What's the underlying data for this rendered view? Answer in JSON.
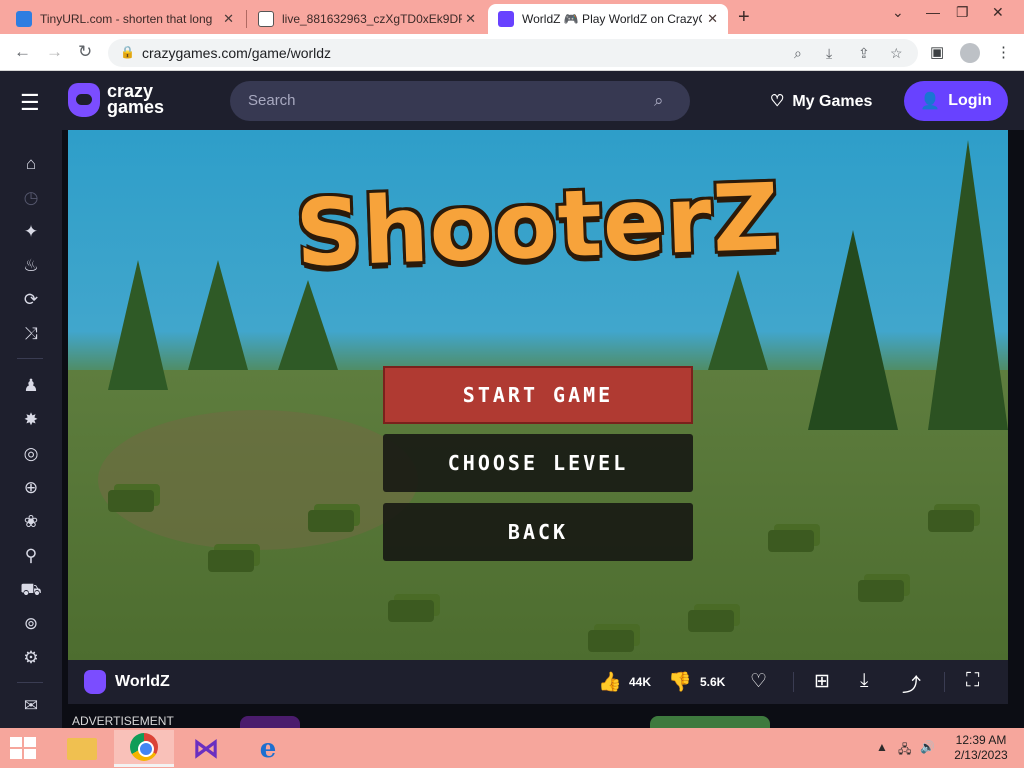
{
  "browser": {
    "tabs": [
      {
        "title": "TinyURL.com - shorten that long",
        "favicon": "tinyurl-icon"
      },
      {
        "title": "live_881632963_czXgTD0xEk9DR",
        "favicon": "file-icon"
      },
      {
        "title": "WorldZ 🎮 Play WorldZ on CrazyG",
        "favicon": "crazygames-icon",
        "active": true
      }
    ],
    "url": "crazygames.com/game/worldz"
  },
  "header": {
    "logo_line1": "crazy",
    "logo_line2": "games",
    "search_placeholder": "Search",
    "my_games": "My Games",
    "login": "Login"
  },
  "sidebar": {
    "icons": [
      "home-icon",
      "recent-icon",
      "new-icon",
      "trending-icon",
      "updated-icon",
      "random-icon",
      "multiplayer-icon",
      "action-icon",
      "adventure-icon",
      "basketball-icon",
      "beauty-icon",
      "bike-icon",
      "car-icon",
      "clicker-icon",
      "driving-icon",
      "mail-icon"
    ]
  },
  "game": {
    "logo_title": "ShooterZ",
    "menu": {
      "start": "START GAME",
      "choose": "CHOOSE LEVEL",
      "back": "BACK"
    }
  },
  "gamebar": {
    "name": "WorldZ",
    "likes": "44K",
    "dislikes": "5.6K"
  },
  "ad_label": "ADVERTISEMENT",
  "taskbar": {
    "time": "12:39 AM",
    "date": "2/13/2023"
  },
  "colors": {
    "accent": "#6842ff",
    "header_bg": "#1e1f2d",
    "start_button": "#b03a32",
    "title_orange": "#f7a33b"
  }
}
